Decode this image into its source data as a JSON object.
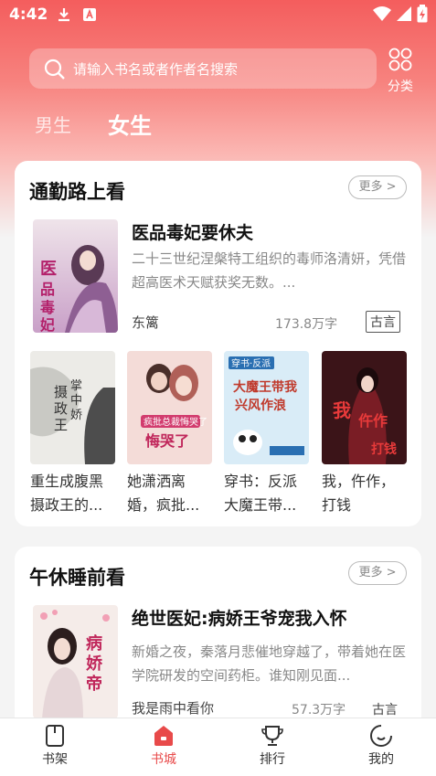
{
  "status_bar": {
    "time": "4:42"
  },
  "search": {
    "placeholder": "请输入书名或者作者名搜索"
  },
  "category": {
    "label": "分类"
  },
  "gender_tabs": [
    {
      "label": "男生"
    },
    {
      "label": "女生"
    }
  ],
  "section1": {
    "title": "通勤路上看",
    "more_label": "更多 >",
    "featured": {
      "title": "医品毒妃要休夫",
      "description": "二十三世纪涅槃特工组织的毒师洛清妍，凭借超高医术天赋获奖无数。...",
      "author": "东篱",
      "words": "173.8万字",
      "tag": "古言",
      "cover_text": "医品毒妃"
    },
    "grid": [
      {
        "title": "重生成腹黑摄政王的...",
        "cover_text": "摄政王的掌中娇"
      },
      {
        "title": "她潇洒离婚，疯批...",
        "cover_text": "疯批总裁悔哭了"
      },
      {
        "title": "穿书：反派大魔王带...",
        "cover_text": "大魔王带我兴风作浪",
        "cover_badge": "穿书·反派"
      },
      {
        "title": "我，仵作，打钱",
        "cover_text": "我仵作打钱"
      }
    ]
  },
  "section2": {
    "title": "午休睡前看",
    "more_label": "更多 >",
    "featured": {
      "title": "绝世医妃:病娇王爷宠我入怀",
      "description": "新婚之夜，秦落月悲催地穿越了，带着她在医学院研发的空间药柜。谁知刚见面...",
      "author": "我是雨中看你",
      "words": "57.3万字",
      "tag": "古言",
      "cover_text": "病娇帝"
    }
  },
  "bottom_nav": [
    {
      "label": "书架",
      "icon": "bookshelf-icon",
      "active": false
    },
    {
      "label": "书城",
      "icon": "store-icon",
      "active": true
    },
    {
      "label": "排行",
      "icon": "trophy-icon",
      "active": false
    },
    {
      "label": "我的",
      "icon": "profile-icon",
      "active": false
    }
  ],
  "colors": {
    "accent": "#e84a4a",
    "header_top": "#f45d5d"
  }
}
